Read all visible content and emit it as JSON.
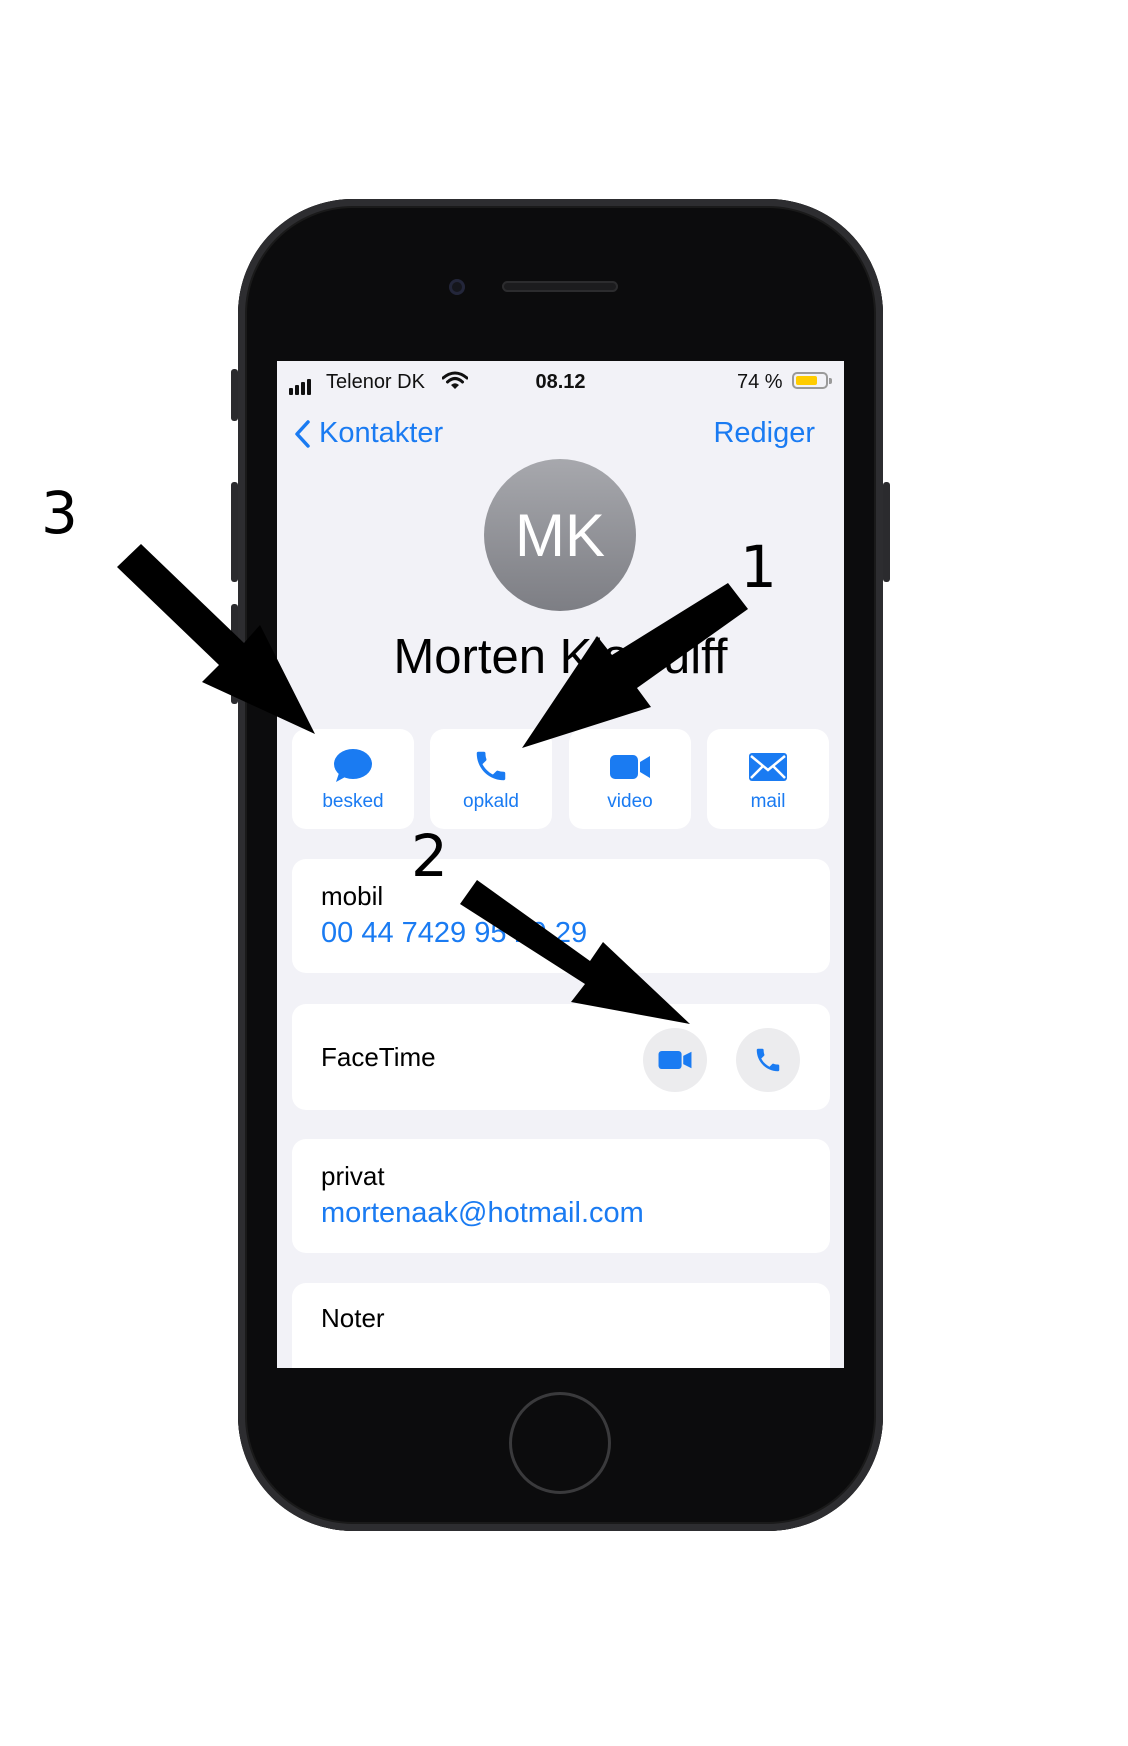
{
  "status_bar": {
    "carrier": "Telenor DK",
    "time": "08.12",
    "battery_pct": "74 %",
    "battery_level": 0.74,
    "signal_icon": "cellular-bars-icon",
    "wifi_icon": "wifi-icon"
  },
  "nav": {
    "back_label": "Kontakter",
    "edit_label": "Rediger"
  },
  "contact": {
    "initials": "MK",
    "name": "Morten Kjærulff"
  },
  "actions": [
    {
      "label": "besked",
      "icon": "message-bubble-icon"
    },
    {
      "label": "opkald",
      "icon": "phone-icon"
    },
    {
      "label": "video",
      "icon": "video-camera-icon"
    },
    {
      "label": "mail",
      "icon": "envelope-icon"
    }
  ],
  "phone": {
    "label": "mobil",
    "value": "00 44 7429 95 29 29"
  },
  "facetime": {
    "label": "FaceTime"
  },
  "email": {
    "label": "privat",
    "value": "mortenaak@hotmail.com"
  },
  "notes": {
    "label": "Noter"
  },
  "annotations": {
    "one": "1",
    "two": "2",
    "three": "3"
  },
  "colors": {
    "accent": "#1a7bf2",
    "background": "#f2f2f7",
    "battery": "#ffcc00"
  }
}
